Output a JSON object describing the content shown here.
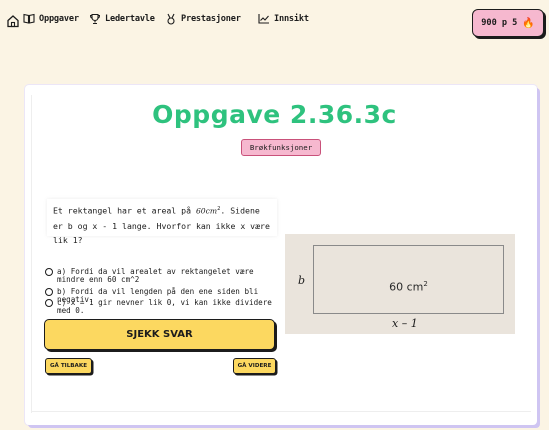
{
  "nav": {
    "items": [
      {
        "label": "Oppgaver",
        "icon": "book-icon"
      },
      {
        "label": "Ledertavle",
        "icon": "trophy-icon"
      },
      {
        "label": "Prestasjoner",
        "icon": "medal-icon"
      },
      {
        "label": "Innsikt",
        "icon": "chart-icon"
      }
    ],
    "home_icon": "home-icon",
    "points": "900 p",
    "streak": "5",
    "streak_icon": "flame-icon"
  },
  "task": {
    "title": "Oppgave 2.36.3c",
    "topic": "Brøkfunksjoner",
    "question_part1": "Et rektangel har et areal på ",
    "question_math": "60cm",
    "question_exp": "2",
    "question_part2": ". Sidene er b og x - 1 lange. Hvorfor kan ikke x være lik 1?",
    "options": [
      "a) Fordi da vil arealet av rektangelet være mindre enn 60 cm^2",
      "b) Fordi da vil lengden på den ene siden bli negativ.",
      "c) x = 1 gir nevner lik 0, vi kan ikke dividere med 0."
    ],
    "check_label": "SJEKK SVAR",
    "back_label": "GÅ TILBAKE",
    "next_label": "GÅ VIDERE"
  },
  "figure": {
    "area_label": "60 cm",
    "area_exp": "2",
    "side_b": "b",
    "side_x": "x – 1",
    "background": "#eae4dc"
  },
  "colors": {
    "background": "#fbf4e4",
    "title_green": "#2ec27e",
    "badge_pink": "#f6b8cf",
    "button_yellow": "#fcd860",
    "card_shadow": "#cfc5f2"
  }
}
